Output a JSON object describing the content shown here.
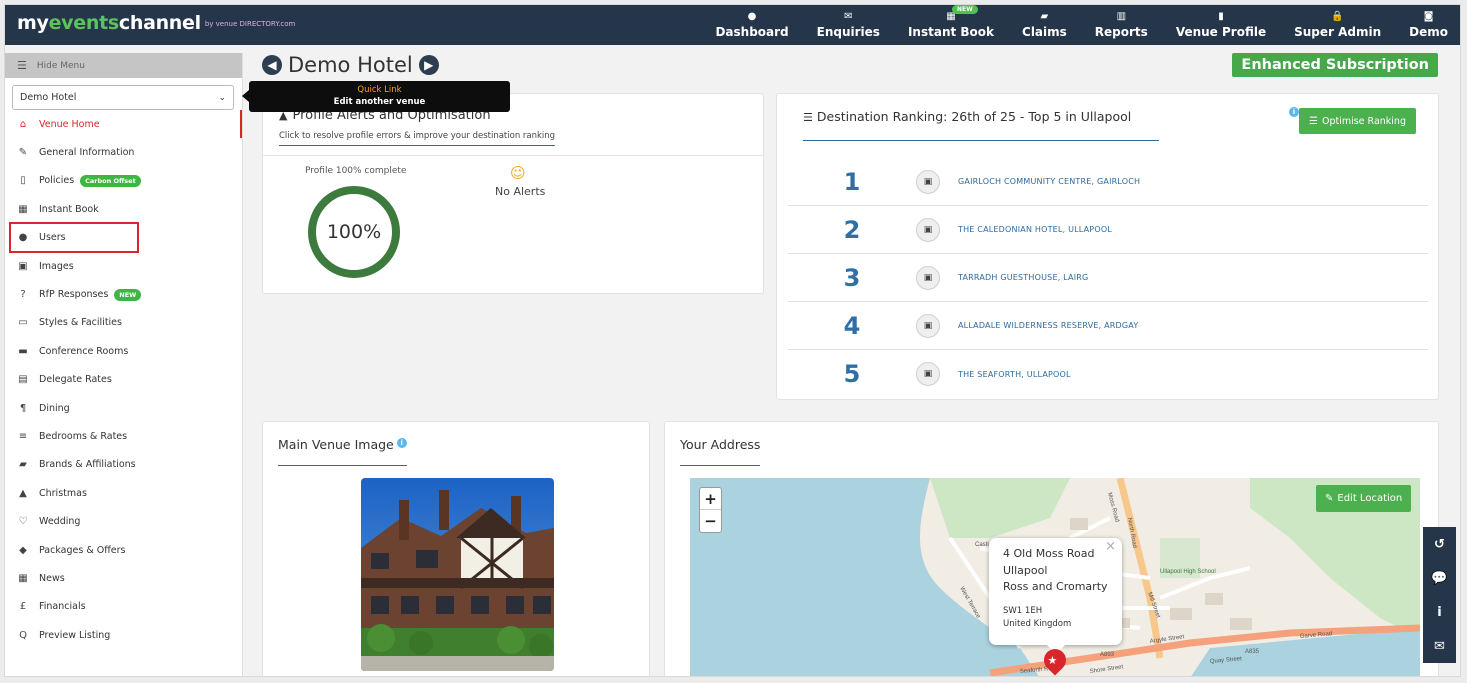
{
  "brand": {
    "part1": "my",
    "part2": "events",
    "part3": "channel",
    "by": "by venue DIRECTORY.com"
  },
  "nav": [
    {
      "icon": "●",
      "label": "Dashboard"
    },
    {
      "icon": "✉",
      "label": "Enquiries"
    },
    {
      "icon": "▦",
      "label": "Instant Book",
      "badge": "NEW"
    },
    {
      "icon": "▰",
      "label": "Claims"
    },
    {
      "icon": "▥",
      "label": "Reports"
    },
    {
      "icon": "▮",
      "label": "Venue Profile"
    },
    {
      "icon": "🔒",
      "label": "Super Admin"
    },
    {
      "icon": "◙",
      "label": "Demo"
    }
  ],
  "sidebar": {
    "hide_menu": "Hide Menu",
    "venue_select": "Demo Hotel",
    "items": [
      {
        "icon": "⌂",
        "label": "Venue Home"
      },
      {
        "icon": "✎",
        "label": "General Information"
      },
      {
        "icon": "▯",
        "label": "Policies",
        "badge": "Carbon Offset"
      },
      {
        "icon": "▦",
        "label": "Instant Book"
      },
      {
        "icon": "●",
        "label": "Users"
      },
      {
        "icon": "▣",
        "label": "Images"
      },
      {
        "icon": "?",
        "label": "RfP Responses",
        "badge": "NEW"
      },
      {
        "icon": "▭",
        "label": "Styles & Facilities"
      },
      {
        "icon": "▬",
        "label": "Conference Rooms"
      },
      {
        "icon": "▤",
        "label": "Delegate Rates"
      },
      {
        "icon": "¶",
        "label": "Dining"
      },
      {
        "icon": "≡",
        "label": "Bedrooms & Rates"
      },
      {
        "icon": "▰",
        "label": "Brands & Affiliations"
      },
      {
        "icon": "▲",
        "label": "Christmas"
      },
      {
        "icon": "♡",
        "label": "Wedding"
      },
      {
        "icon": "◆",
        "label": "Packages & Offers"
      },
      {
        "icon": "▦",
        "label": "News"
      },
      {
        "icon": "£",
        "label": "Financials"
      },
      {
        "icon": "Q",
        "label": "Preview Listing"
      }
    ]
  },
  "tooltip": {
    "title": "Quick Link",
    "subtitle": "Edit another venue"
  },
  "page": {
    "title": "Demo Hotel",
    "subscription": "Enhanced Subscription"
  },
  "alerts": {
    "title": "Profile Alerts and Optimisation",
    "subtitle": "Click to resolve profile errors & improve your destination ranking",
    "complete_label": "Profile 100% complete",
    "percent_text": "100%",
    "percent_value": 100,
    "no_alerts": "No Alerts"
  },
  "ranking": {
    "title": "Destination Ranking: 26th of 25 - Top 5 in Ullapool",
    "optimise_button": "Optimise Ranking",
    "rows": [
      {
        "rank": "1",
        "name": "GAIRLOCH COMMUNITY CENTRE, GAIRLOCH"
      },
      {
        "rank": "2",
        "name": "THE CALEDONIAN HOTEL, ULLAPOOL"
      },
      {
        "rank": "3",
        "name": "TARRADH GUESTHOUSE, LAIRG"
      },
      {
        "rank": "4",
        "name": "ALLADALE WILDERNESS RESERVE, ARDGAY"
      },
      {
        "rank": "5",
        "name": "THE SEAFORTH, ULLAPOOL"
      }
    ]
  },
  "main_image": {
    "title": "Main Venue Image"
  },
  "address": {
    "title": "Your Address",
    "edit_button": "Edit Location",
    "lines": [
      "4 Old Moss Road",
      "Ullapool",
      "Ross and Cromarty"
    ],
    "postcode": "SW1 1EH",
    "country": "United Kingdom",
    "map_labels": [
      "North Road",
      "Mill Street",
      "Garve Road",
      "Argyle Street",
      "A835",
      "A893",
      "Ullapool High School",
      "West Terrace",
      "Castle Terrace",
      "Moss Road",
      "Shore Street",
      "Seaforth Road",
      "Quay Street"
    ]
  },
  "float_bar": [
    "↺",
    "💬",
    "i",
    "✉"
  ]
}
